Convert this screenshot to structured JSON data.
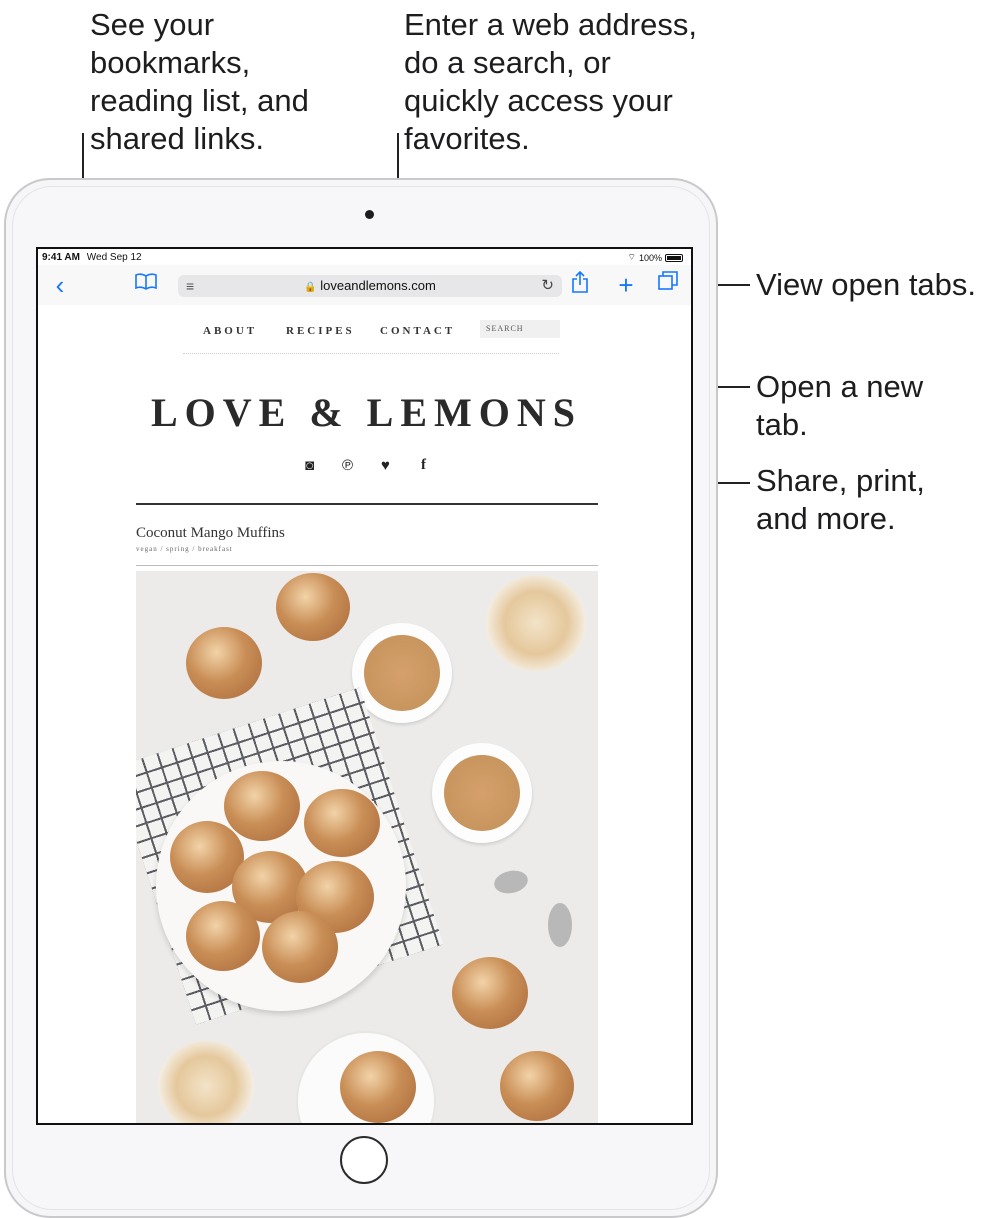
{
  "callouts": {
    "bookmarks": "See your\nbookmarks,\nreading list, and\nshared links.",
    "address": "Enter a web address,\ndo a search, or\nquickly access your\nfavorites.",
    "tabs": "View open tabs.",
    "new_tab": "Open a new tab.",
    "share": "Share, print,\nand more."
  },
  "status_bar": {
    "time": "9:41 AM",
    "date": "Wed Sep 12",
    "wifi_icon": "wifi-icon",
    "battery": "100%"
  },
  "toolbar": {
    "back_icon": "‹",
    "bookmarks_icon": "book-icon",
    "reader_icon": "reader-icon",
    "url": "loveandlemons.com",
    "lock_icon": "🔒",
    "reload_icon": "↻",
    "share_icon": "share-icon",
    "new_tab_icon": "+",
    "tabs_icon": "tabs-icon"
  },
  "site": {
    "nav": [
      "ABOUT",
      "RECIPES",
      "CONTACT"
    ],
    "search_placeholder": "SEARCH",
    "logo": "LOVE & LEMONS",
    "social": [
      "◙",
      "℗",
      "♥",
      "f"
    ],
    "post_title": "Coconut Mango Muffins",
    "post_tags": "vegan / spring / breakfast"
  },
  "colors": {
    "accent": "#1677ff",
    "text": "#1d1d1f"
  }
}
